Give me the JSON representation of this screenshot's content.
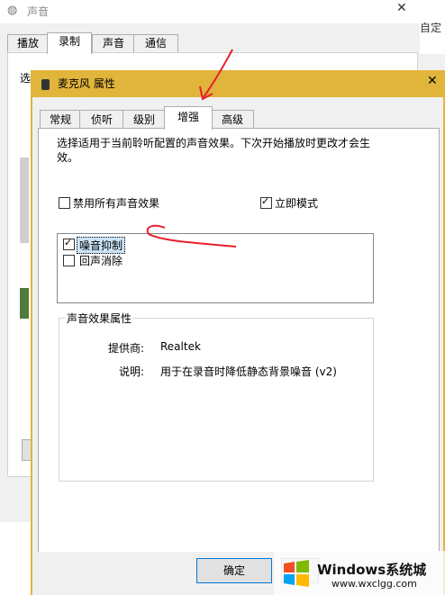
{
  "background_window": {
    "title": "声音",
    "close_symbol": "✕",
    "right_edge_text": "自定",
    "tabs": [
      {
        "label": "播放"
      },
      {
        "label": "录制",
        "active": true
      },
      {
        "label": "声音"
      },
      {
        "label": "通信"
      }
    ],
    "select_text": "选"
  },
  "dialog": {
    "title": "麦克风 属性",
    "close_symbol": "✕",
    "tabs": [
      {
        "label": "常规"
      },
      {
        "label": "侦听"
      },
      {
        "label": "级别"
      },
      {
        "label": "增强",
        "active": true
      },
      {
        "label": "高级"
      }
    ],
    "description": "选择适用于当前聆听配置的声音效果。下次开始播放时更改才会生效。",
    "disable_all_label": "禁用所有声音效果",
    "disable_all_checked": false,
    "immediate_mode_label": "立即模式",
    "immediate_mode_checked": true,
    "effects": [
      {
        "label": "噪音抑制",
        "checked": true,
        "selected": true
      },
      {
        "label": "回声消除",
        "checked": false
      }
    ],
    "properties": {
      "group_title": "声音效果属性",
      "provider_label": "提供商:",
      "provider_value": "Realtek",
      "description_label": "说明:",
      "description_value": "用于在录音时降低静态背景噪音 (v2)"
    },
    "ok_label": "确定"
  },
  "watermark": {
    "brand": "Windows系统城",
    "url": "www.wxclgg.com"
  },
  "colors": {
    "dialog_title_bar": "#e1b43b",
    "annotation_red": "#e8202a",
    "selection": "#cce4f7"
  },
  "icons": [
    "speaker-icon",
    "microphone-icon",
    "check-icon",
    "windows-logo-icon"
  ]
}
